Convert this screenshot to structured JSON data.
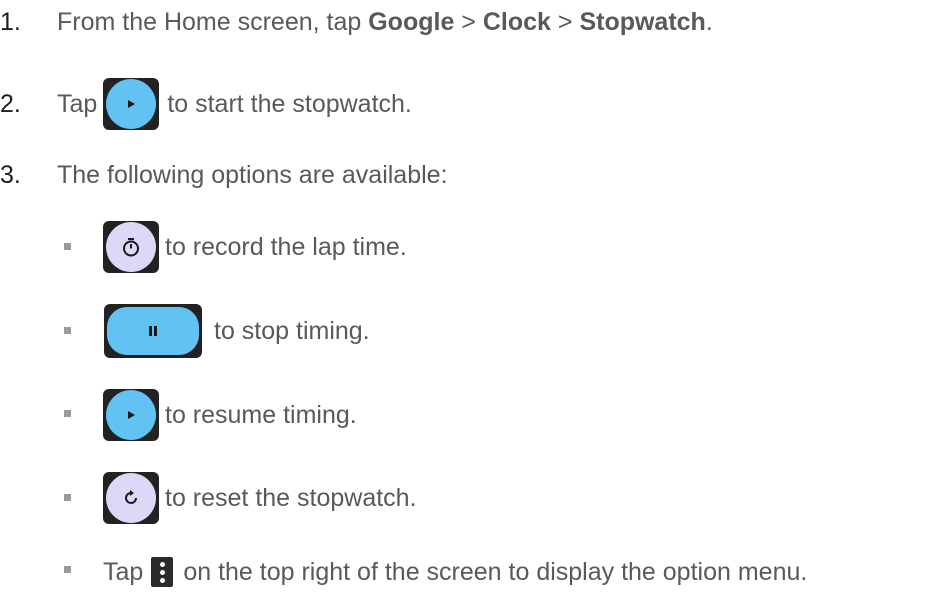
{
  "steps": [
    {
      "num": "1.",
      "parts": [
        "From the Home screen, tap ",
        "Google",
        " > ",
        "Clock",
        " > ",
        "Stopwatch",
        "."
      ]
    },
    {
      "num": "2.",
      "before": "Tap",
      "after": "to start the stopwatch.",
      "icon": "play-icon"
    },
    {
      "num": "3.",
      "text": "The following options are available:"
    }
  ],
  "options": [
    {
      "icon": "lap-timer-icon",
      "text": "to record the lap time."
    },
    {
      "icon": "pause-icon",
      "text": "to stop timing."
    },
    {
      "icon": "play-icon",
      "text": "to resume timing."
    },
    {
      "icon": "reset-icon",
      "text": "to reset the stopwatch."
    },
    {
      "icon": "more-vert-icon",
      "before": "Tap",
      "text": "on the top right of the screen to display the option menu."
    }
  ],
  "colors": {
    "accent_blue": "#62c2f2",
    "lavender": "#ddd7f8",
    "text": "#595959"
  }
}
